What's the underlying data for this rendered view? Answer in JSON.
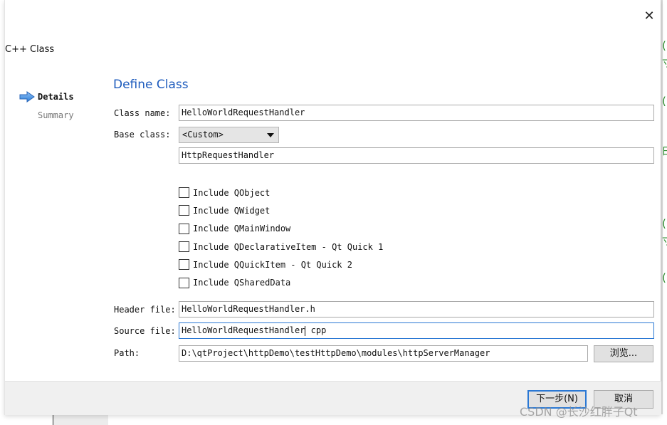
{
  "dialog": {
    "title": "C++ Class",
    "close_icon": "close-icon"
  },
  "steps": [
    {
      "label": "Details",
      "active": true,
      "icon": "arrow-right-icon"
    },
    {
      "label": "Summary",
      "active": false
    }
  ],
  "page": {
    "title": "Define Class"
  },
  "form": {
    "class_name_label": "Class name:",
    "class_name_value": "HelloWorldRequestHandler",
    "base_class_label": "Base class:",
    "base_class_selected": "<Custom>",
    "custom_base_value": "HttpRequestHandler",
    "checkboxes": [
      {
        "label": "Include QObject",
        "checked": false
      },
      {
        "label": "Include QWidget",
        "checked": false
      },
      {
        "label": "Include QMainWindow",
        "checked": false
      },
      {
        "label": "Include QDeclarativeItem - Qt Quick 1",
        "checked": false
      },
      {
        "label": "Include QQuickItem - Qt Quick 2",
        "checked": false
      },
      {
        "label": "Include QSharedData",
        "checked": false
      }
    ],
    "header_file_label": "Header file:",
    "header_file_value": "HelloWorldRequestHandler.h",
    "source_file_label": "Source file:",
    "source_file_value_before_caret": "HelloWorldRequestHandler",
    "source_file_value_after_caret": " cpp",
    "path_label": "Path:",
    "path_value": "D:\\qtProject\\httpDemo\\testHttpDemo\\modules\\httpServerManager",
    "browse_label": "浏览..."
  },
  "footer": {
    "next_label": "下一步(N)",
    "cancel_label": "取消"
  },
  "background": {
    "glyphs": [
      "(",
      "寸",
      "(",
      "曰",
      "(",
      "寸",
      "("
    ]
  },
  "watermark": "CSDN @长沙红胖子Qt",
  "colors": {
    "accent": "#2a78d4",
    "title_blue": "#1d5bbd",
    "footer_bg": "#f0f0f0"
  }
}
